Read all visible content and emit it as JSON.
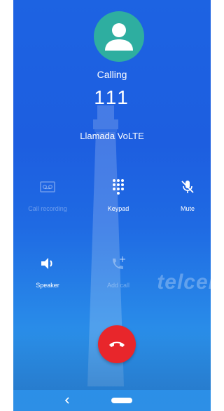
{
  "call": {
    "status": "Calling",
    "number": "111",
    "network_label": "Llamada VoLTE"
  },
  "controls": {
    "call_recording": {
      "label": "Call recording",
      "icon": "voicemail-icon",
      "enabled": false
    },
    "keypad": {
      "label": "Keypad",
      "icon": "dialpad-icon",
      "enabled": true
    },
    "mute": {
      "label": "Mute",
      "icon": "mic-off-icon",
      "enabled": true
    },
    "speaker": {
      "label": "Speaker",
      "icon": "volume-icon",
      "enabled": true
    },
    "add_call": {
      "label": "Add call",
      "icon": "add-call-icon",
      "enabled": false
    }
  },
  "wallpaper_brand": "telcel",
  "colors": {
    "background_top": "#1d63e2",
    "background_bottom": "#2d8fe6",
    "avatar": "#2eaea0",
    "end_call": "#e8262b"
  }
}
